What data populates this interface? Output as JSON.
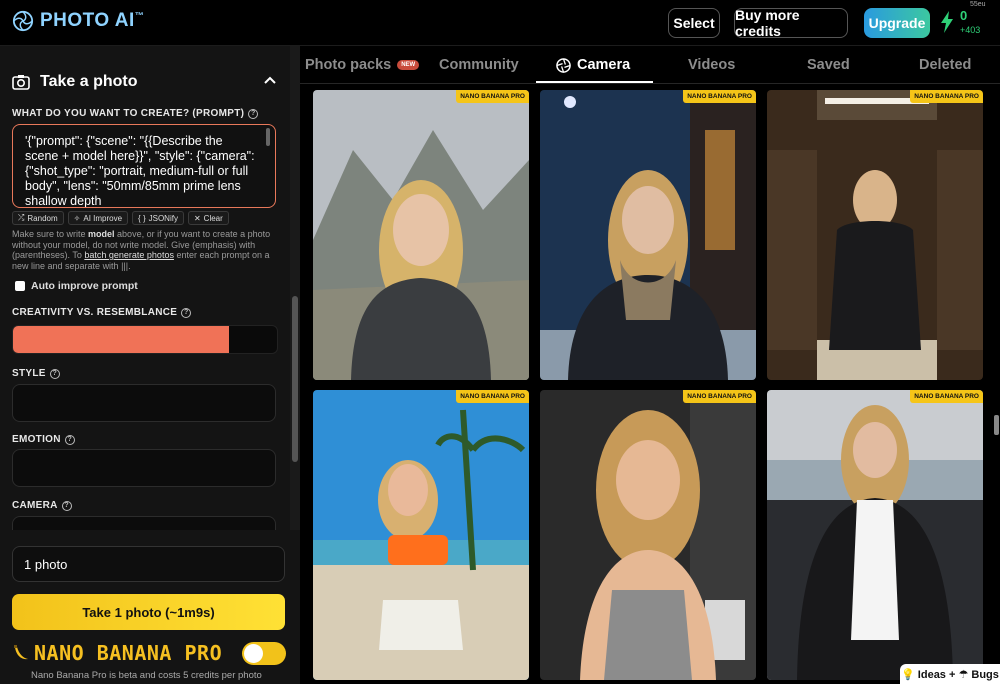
{
  "header": {
    "logo_text": "PHOTO AI",
    "logo_tm": "™",
    "select_label": "Select",
    "buy_credits_label": "Buy more credits",
    "upgrade_label": "Upgrade",
    "credits_value": "0",
    "credits_delta": "+403",
    "corner_note": "55eu"
  },
  "panel": {
    "section_title": "Take a photo",
    "prompt_label": "WHAT DO YOU WANT TO CREATE? (PROMPT)",
    "prompt_value": "'{\"prompt\": {\"scene\": \"{{Describe the scene + model here}}\", \"style\": {\"camera\": {\"shot_type\": \"portrait, medium-full or full body\", \"lens\": \"50mm/85mm prime lens shallow depth",
    "tools": {
      "random": "Random",
      "ai_improve": "AI Improve",
      "jsonify": "JSONify",
      "clear": "Clear"
    },
    "hint_pre": "Make sure to write ",
    "hint_model": "model",
    "hint_mid": " above, or if you want to create a photo without your model, do not write model. Give (emphasis) with (parentheses). To ",
    "hint_link": "batch generate photos",
    "hint_post": " enter each prompt on a new line and separate with |||.",
    "auto_improve_label": "Auto improve prompt",
    "creativity_label": "CREATIVITY VS. RESEMBLANCE",
    "creativity_value": 0.82,
    "style_label": "STYLE",
    "emotion_label": "EMOTION",
    "camera_label": "CAMERA"
  },
  "bottom": {
    "photo_count": "1 photo",
    "take_button": "Take 1 photo (~1m9s)",
    "nano_title": "NANO BANANA PRO",
    "nano_note": "Nano Banana Pro is beta and costs 5 credits per photo",
    "nano_enabled": true
  },
  "tabs": {
    "photo_packs": "Photo packs",
    "new_badge": "NEW",
    "community": "Community",
    "camera": "Camera",
    "videos": "Videos",
    "saved": "Saved",
    "deleted": "Deleted",
    "active": "camera"
  },
  "photos": [
    {
      "badge": "NANO BANANA PRO"
    },
    {
      "badge": "NANO BANANA PRO"
    },
    {
      "badge": "NANO BANANA PRO"
    },
    {
      "badge": "NANO BANANA PRO"
    },
    {
      "badge": "NANO BANANA PRO"
    },
    {
      "badge": "NANO BANANA PRO"
    }
  ],
  "footer": {
    "ideas_label": "Ideas + ☂ Bugs"
  },
  "colors": {
    "accent_orange": "#f07257",
    "accent_yellow": "#f5c518",
    "credits_green": "#2fd178",
    "upgrade_start": "#2a9adf",
    "upgrade_end": "#3cc8a0"
  }
}
